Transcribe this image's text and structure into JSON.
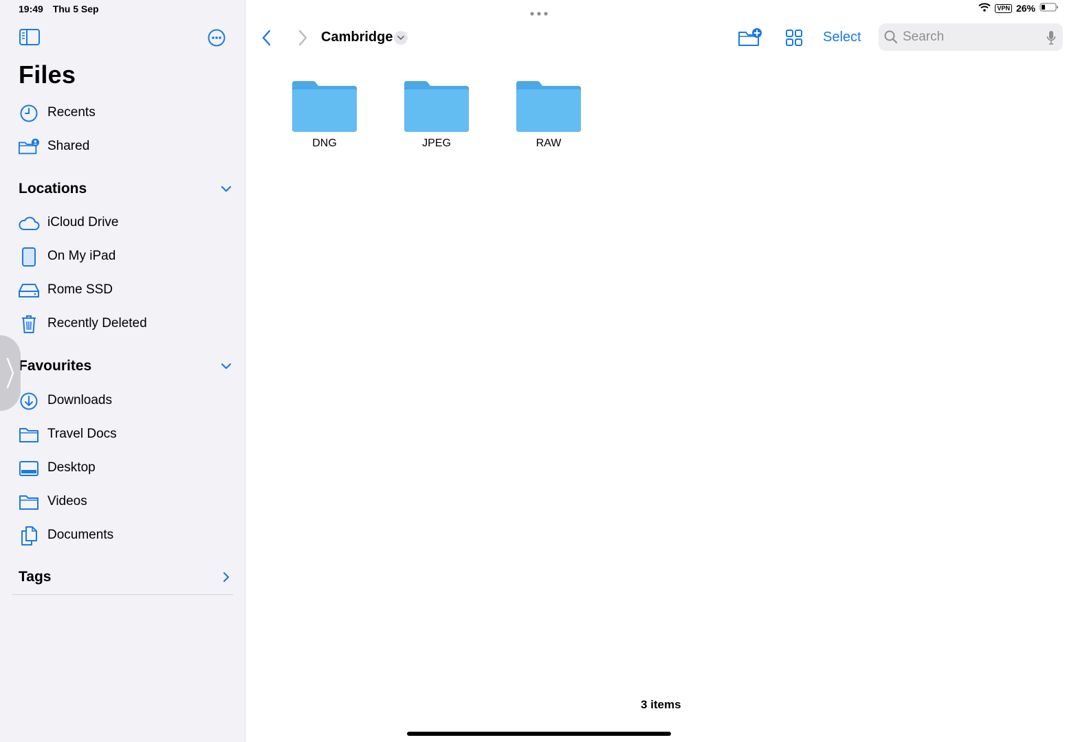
{
  "status": {
    "time": "19:49",
    "date": "Thu 5 Sep",
    "vpn": "VPN",
    "battery": "26%"
  },
  "sidebar": {
    "title": "Files",
    "top_items": [
      {
        "label": "Recents",
        "icon": "clock-icon"
      },
      {
        "label": "Shared",
        "icon": "shared-folder-icon"
      }
    ],
    "locations": {
      "header": "Locations",
      "items": [
        {
          "label": "iCloud Drive",
          "icon": "cloud-icon"
        },
        {
          "label": "On My iPad",
          "icon": "ipad-icon"
        },
        {
          "label": "Rome SSD",
          "icon": "drive-icon"
        },
        {
          "label": "Recently Deleted",
          "icon": "trash-icon"
        }
      ]
    },
    "favourites": {
      "header": "Favourites",
      "items": [
        {
          "label": "Downloads",
          "icon": "download-icon"
        },
        {
          "label": "Travel Docs",
          "icon": "folder-icon"
        },
        {
          "label": "Desktop",
          "icon": "desktop-icon"
        },
        {
          "label": "Videos",
          "icon": "folder-icon"
        },
        {
          "label": "Documents",
          "icon": "documents-icon"
        }
      ]
    },
    "tags": {
      "header": "Tags"
    }
  },
  "toolbar": {
    "breadcrumb": "Cambridge",
    "select_label": "Select",
    "search_placeholder": "Search"
  },
  "folders": [
    {
      "name": "DNG"
    },
    {
      "name": "JPEG"
    },
    {
      "name": "RAW"
    }
  ],
  "footer": {
    "count": "3 items"
  },
  "colors": {
    "accent": "#1a7ae0",
    "folder": "#5ab8f0",
    "sidebar_bg": "#f2f2f7"
  }
}
